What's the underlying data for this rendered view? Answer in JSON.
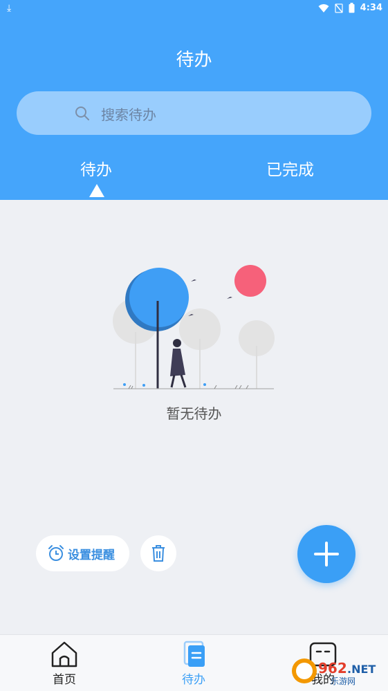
{
  "status_bar": {
    "time": "4:34",
    "icons": [
      "download-icon",
      "wifi-icon",
      "no-sim-icon",
      "battery-icon"
    ]
  },
  "header": {
    "title": "待办",
    "search_placeholder": "搜索待办",
    "tabs": [
      {
        "label": "待办",
        "active": true
      },
      {
        "label": "已完成",
        "active": false
      }
    ],
    "accent": "#45a5fb"
  },
  "empty_state": {
    "message": "暂无待办"
  },
  "actions": {
    "reminder_label": "设置提醒",
    "delete_icon": "trash-icon",
    "add_icon": "plus-icon"
  },
  "bottom_nav": {
    "items": [
      {
        "label": "首页",
        "icon": "home-icon",
        "active": false
      },
      {
        "label": "待办",
        "icon": "document-icon",
        "active": true
      },
      {
        "label": "我的",
        "icon": "profile-icon",
        "active": false
      }
    ]
  },
  "watermark": {
    "text": "962.NET",
    "subtext": "乐游网"
  }
}
